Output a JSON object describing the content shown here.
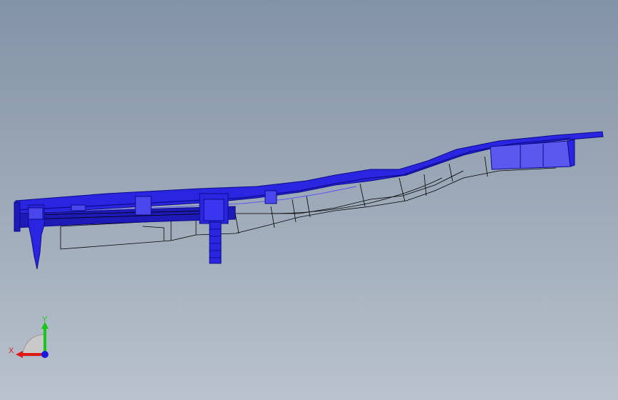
{
  "viewport": {
    "background_top": "#8393a6",
    "background_bottom": "#b9c2cd"
  },
  "model": {
    "part_color": "#2a25e0",
    "part_dark": "#0d0b8a",
    "part_light": "#5a55f0",
    "wire_color": "#000000"
  },
  "triad": {
    "x_label": "X",
    "y_label": "Y",
    "x_color": "#e01818",
    "y_color": "#18c818",
    "z_color": "#1818e0"
  }
}
